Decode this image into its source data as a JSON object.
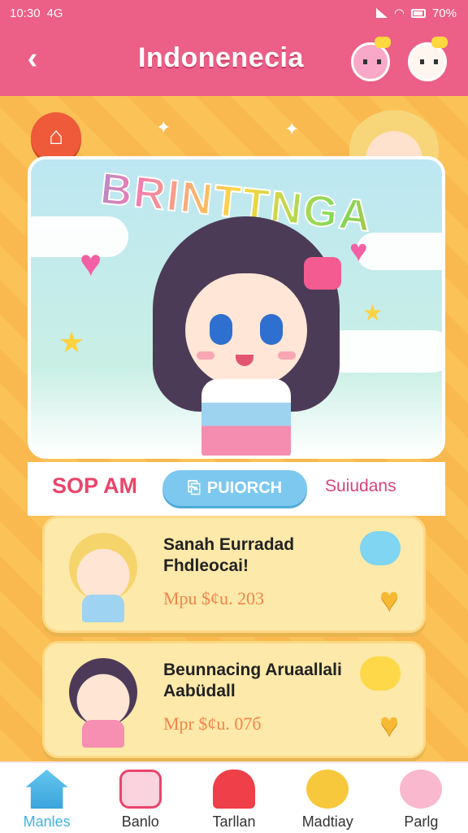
{
  "status_bar": {
    "time": "10:30",
    "network": "4G",
    "battery": "70%"
  },
  "app_bar": {
    "title": "Indonenecia",
    "back_icon": "arrow-left-icon"
  },
  "hero": {
    "title": "BRINTTNGA"
  },
  "filters": {
    "left": "SOP AM",
    "pill": "PUIORCH",
    "pill_icon": "bag-icon",
    "right": "Suiudans"
  },
  "cards": [
    {
      "title": "Sanah Eurradad Fhdleocai!",
      "price": "Mpu $¢u. 203"
    },
    {
      "title": "Beunnacing Aruaallali Aabüdall",
      "price": "Mpr $¢u. 07б"
    }
  ],
  "nav": [
    {
      "label": "Manles",
      "icon": "home-icon",
      "active": true
    },
    {
      "label": "Banlo",
      "icon": "gift-box-icon"
    },
    {
      "label": "Tarllan",
      "icon": "shop-icon"
    },
    {
      "label": "Madtiay",
      "icon": "bear-icon"
    },
    {
      "label": "Parlg",
      "icon": "pig-icon"
    }
  ],
  "colors": {
    "primary": "#ec5f86",
    "background": "#fbc258",
    "accent": "#7dc8ef",
    "card": "#fde9a9"
  }
}
